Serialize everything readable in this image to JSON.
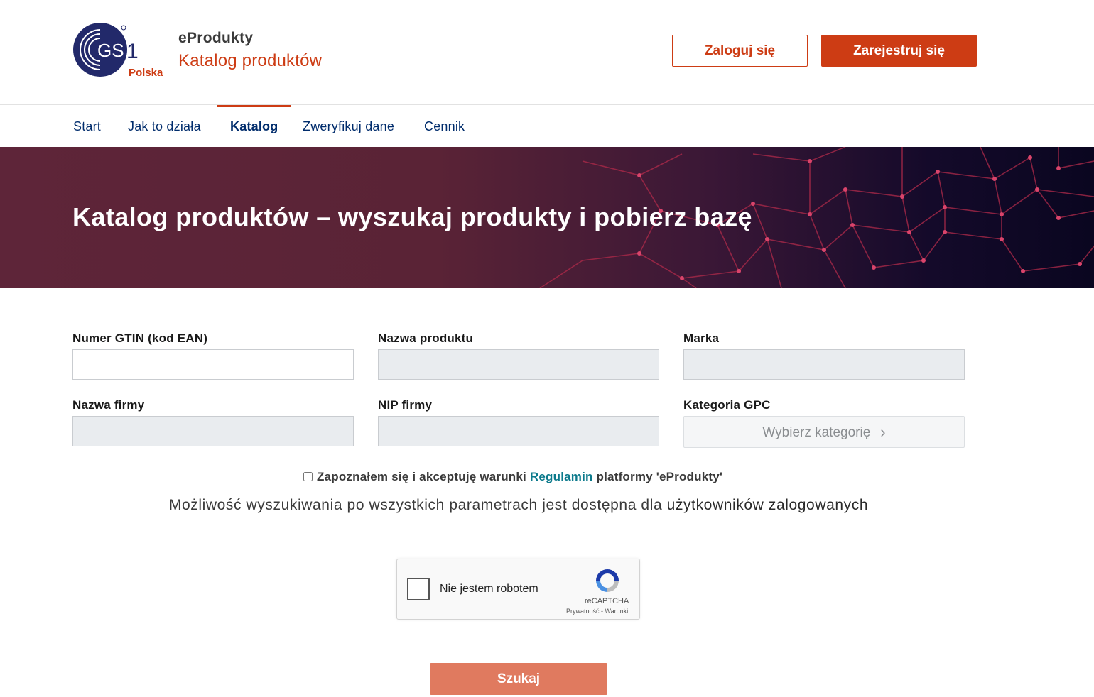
{
  "header": {
    "logo": {
      "mark": "GS1",
      "region": "Polska"
    },
    "brand_title": "eProdukty",
    "brand_subtitle": "Katalog produktów",
    "login_label": "Zaloguj się",
    "register_label": "Zarejestruj się"
  },
  "nav": {
    "items": [
      {
        "label": "Start"
      },
      {
        "label": "Jak to działa"
      },
      {
        "label": "Katalog",
        "active": true
      },
      {
        "label": "Zweryfikuj dane"
      },
      {
        "label": "Cennik"
      }
    ]
  },
  "hero": {
    "title": "Katalog produktów – wyszukaj produkty i pobierz bazę"
  },
  "form": {
    "gtin_label": "Numer GTIN (kod EAN)",
    "gtin_value": "",
    "product_name_label": "Nazwa produktu",
    "brand_label": "Marka",
    "company_label": "Nazwa firmy",
    "nip_label": "NIP firmy",
    "gpc_label": "Kategoria GPC",
    "gpc_button_label": "Wybierz kategorię",
    "terms_prefix": "Zapoznałem się i akceptuję warunki",
    "terms_link": "Regulamin",
    "terms_suffix": "platformy 'eProdukty'",
    "terms_checked": false,
    "info_text": "Możliwość wyszukiwania po wszystkich parametrach jest dostępna dla",
    "info_emphasis": "użytkowników zalogowanych",
    "search_label": "Szukaj"
  },
  "captcha": {
    "label": "Nie jestem robotem",
    "brand": "reCAPTCHA",
    "links": "Prywatność - Warunki"
  },
  "colors": {
    "accent": "#cd3c14",
    "nav_text": "#002c6c",
    "search_button": "#e07a5f",
    "link": "#0c7a8c"
  },
  "icons": {
    "logo": "gs1-logo",
    "gpc_chevron": "chevron-right-icon",
    "captcha": "recaptcha-icon"
  }
}
